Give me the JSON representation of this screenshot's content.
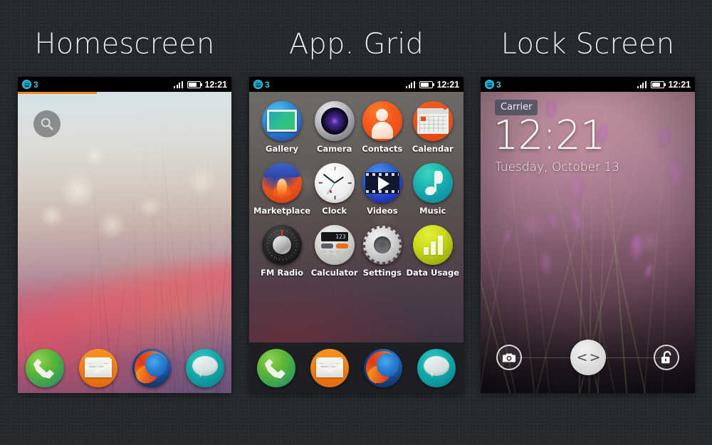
{
  "background_color": "#272a2f",
  "panels": [
    {
      "title": "Homescreen"
    },
    {
      "title": "App. Grid"
    },
    {
      "title": "Lock Screen"
    }
  ],
  "status_bar": {
    "notification_count": "3",
    "notification_icon": "messages-badge-icon",
    "signal_icon": "signal-bars-icon",
    "battery_icon": "battery-icon",
    "time": "12:21"
  },
  "homescreen": {
    "search_icon": "search-icon",
    "progress_percent": 37,
    "progress_color": "#f08a25"
  },
  "dock": {
    "items": [
      {
        "name": "phone-icon",
        "label": "Phone",
        "color": "#4fb13a"
      },
      {
        "name": "email-icon",
        "label": "Email",
        "color": "#ef7b16"
      },
      {
        "name": "firefox-icon",
        "label": "Browser",
        "color": "#e8541b"
      },
      {
        "name": "messages-icon",
        "label": "Messages",
        "color": "#13a8a8"
      }
    ]
  },
  "app_grid": {
    "apps": [
      {
        "name": "gallery-icon",
        "label": "Gallery"
      },
      {
        "name": "camera-icon",
        "label": "Camera"
      },
      {
        "name": "contacts-icon",
        "label": "Contacts"
      },
      {
        "name": "calendar-icon",
        "label": "Calendar"
      },
      {
        "name": "marketplace-icon",
        "label": "Marketplace"
      },
      {
        "name": "clock-icon",
        "label": "Clock"
      },
      {
        "name": "videos-icon",
        "label": "Videos"
      },
      {
        "name": "music-icon",
        "label": "Music"
      },
      {
        "name": "fm-radio-icon",
        "label": "FM Radio"
      },
      {
        "name": "calculator-icon",
        "label": "Calculator"
      },
      {
        "name": "settings-icon",
        "label": "Settings"
      },
      {
        "name": "data-usage-icon",
        "label": "Data Usage"
      }
    ],
    "calculator_display": "123"
  },
  "lock_screen": {
    "carrier": "Carrier",
    "clock": "12:21",
    "date": "Tuesday, October 13",
    "camera_icon": "camera-icon",
    "unlock_icon": "unlock-padlock-icon",
    "slider_glyph": "< >"
  }
}
